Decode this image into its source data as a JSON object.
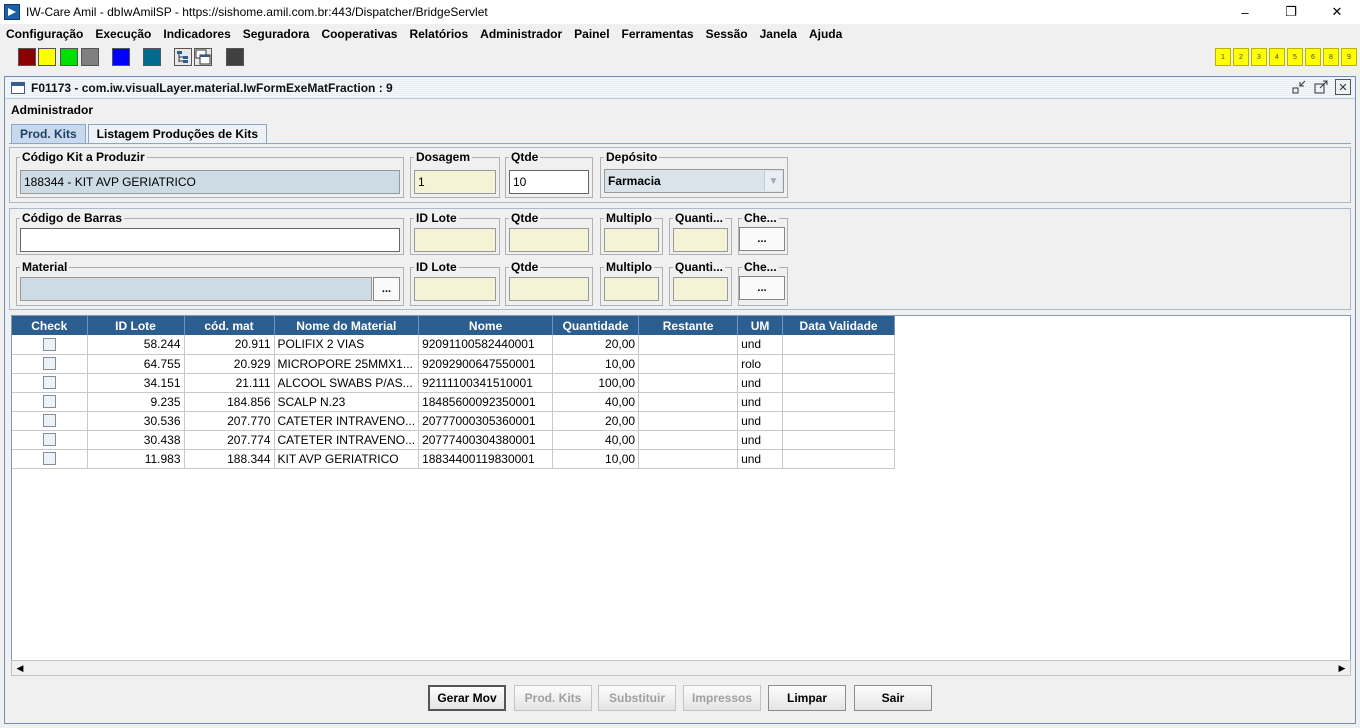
{
  "window": {
    "title": "IW-Care Amil - dbIwAmilSP - https://sishome.amil.com.br:443/Dispatcher/BridgeServlet",
    "min": "–",
    "restore": "❐",
    "close": "✕"
  },
  "menu": [
    "Configuração",
    "Execução",
    "Indicadores",
    "Seguradora",
    "Cooperativas",
    "Relatórios",
    "Administrador",
    "Painel",
    "Ferramentas",
    "Sessão",
    "Janela",
    "Ajuda"
  ],
  "toolbar": {
    "swatches": [
      "#8b0000",
      "#ffff00",
      "#00e000",
      "#808080",
      "#0000ff",
      "#006b8f",
      "#404040"
    ],
    "numbers": [
      "1",
      "2",
      "3",
      "4",
      "5",
      "6",
      "8",
      "9"
    ]
  },
  "frame": {
    "title": "F01173 - com.iw.visualLayer.material.IwFormExeMatFraction : 9",
    "role": "Administrador",
    "tabs": [
      "Prod. Kits",
      "Listagem Produções de Kits"
    ]
  },
  "kit": {
    "codigo_label": "Código Kit a Produzir",
    "codigo_value": "188344 - KIT AVP GERIATRICO",
    "dosagem_label": "Dosagem",
    "dosagem_value": "1",
    "qtde_label": "Qtde",
    "qtde_value": "10",
    "deposito_label": "Depósito",
    "deposito_value": "Farmacia"
  },
  "barcode": {
    "label": "Código de Barras",
    "value": "",
    "id_lote_label": "ID Lote",
    "qtde_label": "Qtde",
    "multiplo_label": "Multiplo",
    "quanti_label": "Quanti...",
    "che_label": "Che...",
    "btn": "..."
  },
  "material": {
    "label": "Material",
    "value": "",
    "btn": "...",
    "id_lote_label": "ID Lote",
    "qtde_label": "Qtde",
    "multiplo_label": "Multiplo",
    "quanti_label": "Quanti...",
    "che_label": "Che...",
    "che_btn": "..."
  },
  "table": {
    "headers": [
      "Check",
      "ID Lote",
      "cód. mat",
      "Nome do Material",
      "Nome",
      "Quantidade",
      "Restante",
      "UM",
      "Data Validade"
    ],
    "rows": [
      [
        "58.244",
        "20.911",
        "POLIFIX 2 VIAS",
        "92091100582440001",
        "20,00",
        "",
        "und",
        ""
      ],
      [
        "64.755",
        "20.929",
        "MICROPORE 25MMX1...",
        "92092900647550001",
        "10,00",
        "",
        "rolo",
        ""
      ],
      [
        "34.151",
        "21.111",
        "ALCOOL SWABS P/AS...",
        "92111100341510001",
        "100,00",
        "",
        "und",
        ""
      ],
      [
        "9.235",
        "184.856",
        "SCALP N.23",
        "18485600092350001",
        "40,00",
        "",
        "und",
        ""
      ],
      [
        "30.536",
        "207.770",
        "CATETER INTRAVENO...",
        "20777000305360001",
        "20,00",
        "",
        "und",
        ""
      ],
      [
        "30.438",
        "207.774",
        "CATETER INTRAVENO...",
        "20777400304380001",
        "40,00",
        "",
        "und",
        ""
      ],
      [
        "11.983",
        "188.344",
        "KIT AVP GERIATRICO",
        "18834400119830001",
        "10,00",
        "",
        "und",
        ""
      ]
    ]
  },
  "buttons": {
    "gerar": "Gerar Mov",
    "prod_kits": "Prod. Kits",
    "substituir": "Substituir",
    "impressos": "Impressos",
    "limpar": "Limpar",
    "sair": "Sair"
  }
}
